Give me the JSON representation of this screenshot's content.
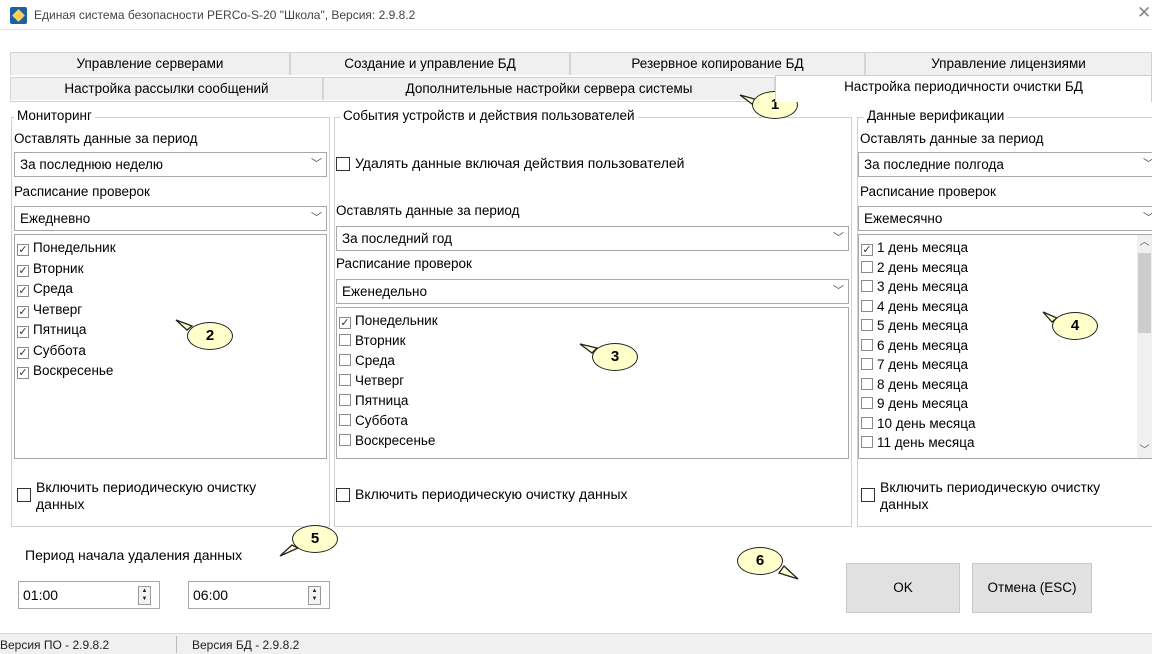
{
  "window": {
    "title": "Единая система безопасности PERCo-S-20 \"Школа\", Версия: 2.9.8.2",
    "close_symbol": "✕"
  },
  "tabs": {
    "row1": [
      "Управление серверами",
      "Создание и управление БД",
      "Резервное копирование БД",
      "Управление лицензиями"
    ],
    "row2": [
      "Настройка рассылки сообщений",
      "Дополнительные настройки сервера системы",
      "Настройка периодичности  очистки БД"
    ],
    "active": "Настройка периодичности  очистки БД"
  },
  "monitoring": {
    "legend": "Мониторинг",
    "keep_label": "Оставлять данные за период",
    "keep_value": "За последнюю неделю",
    "schedule_label": "Расписание проверок",
    "schedule_value": "Ежедневно",
    "days": [
      {
        "label": "Понедельник",
        "checked": true
      },
      {
        "label": "Вторник",
        "checked": true
      },
      {
        "label": "Среда",
        "checked": true
      },
      {
        "label": "Четверг",
        "checked": true
      },
      {
        "label": "Пятница",
        "checked": true
      },
      {
        "label": "Суббота",
        "checked": true
      },
      {
        "label": "Воскресенье",
        "checked": true
      }
    ],
    "enable_label": "Включить периодическую очистку данных",
    "enable_checked": false
  },
  "events": {
    "legend": "События устройств и действия пользователей",
    "delete_user_actions_label": "Удалять данные включая действия пользователей",
    "delete_user_actions_checked": false,
    "keep_label": "Оставлять данные за период",
    "keep_value": "За последний год",
    "schedule_label": "Расписание проверок",
    "schedule_value": "Еженедельно",
    "days": [
      {
        "label": "Понедельник",
        "checked": true
      },
      {
        "label": "Вторник",
        "checked": false
      },
      {
        "label": "Среда",
        "checked": false
      },
      {
        "label": "Четверг",
        "checked": false
      },
      {
        "label": "Пятница",
        "checked": false
      },
      {
        "label": "Суббота",
        "checked": false
      },
      {
        "label": "Воскресенье",
        "checked": false
      }
    ],
    "enable_label": "Включить периодическую очистку данных",
    "enable_checked": false
  },
  "verification": {
    "legend": "Данные верификации",
    "keep_label": "Оставлять данные за период",
    "keep_value": "За последние полгода",
    "schedule_label": "Расписание проверок",
    "schedule_value": "Ежемесячно",
    "days": [
      {
        "label": "1 день месяца",
        "checked": true
      },
      {
        "label": "2 день месяца",
        "checked": false
      },
      {
        "label": "3 день месяца",
        "checked": false
      },
      {
        "label": "4 день месяца",
        "checked": false
      },
      {
        "label": "5 день месяца",
        "checked": false
      },
      {
        "label": "6 день месяца",
        "checked": false
      },
      {
        "label": "7 день месяца",
        "checked": false
      },
      {
        "label": "8 день месяца",
        "checked": false
      },
      {
        "label": "9 день месяца",
        "checked": false
      },
      {
        "label": "10 день месяца",
        "checked": false
      },
      {
        "label": "11 день месяца",
        "checked": false
      }
    ],
    "enable_label": "Включить периодическую очистку данных",
    "enable_checked": false
  },
  "period": {
    "label": "Период начала удаления данных",
    "start": "01:00",
    "end": "06:00"
  },
  "buttons": {
    "ok": "OK",
    "cancel": "Отмена (ESC)"
  },
  "status": {
    "software_version": "Версия ПО - 2.9.8.2",
    "db_version": "Версия БД - 2.9.8.2"
  },
  "callouts": [
    "1",
    "2",
    "3",
    "4",
    "5",
    "6"
  ],
  "colors": {
    "callout_fill": "#ffffcc",
    "app_icon": "#1f5fa8"
  }
}
